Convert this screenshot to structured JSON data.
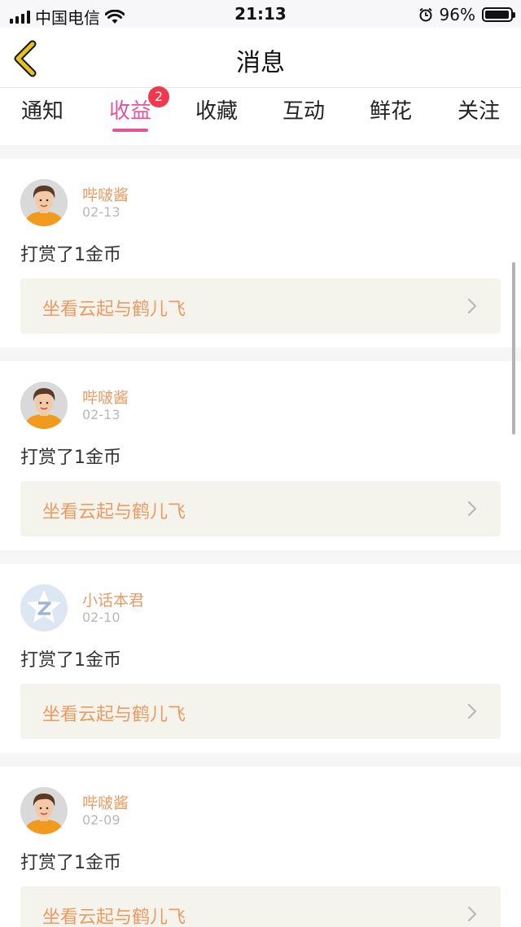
{
  "status_bar": {
    "carrier": "中国电信",
    "time": "21:13",
    "battery": "96%",
    "battery_level": 0.96
  },
  "nav": {
    "title": "消息",
    "back_icon": "chevron-left-icon"
  },
  "tabs": [
    {
      "label": "通知"
    },
    {
      "label": "收益",
      "badge": "2",
      "active": true
    },
    {
      "label": "收藏"
    },
    {
      "label": "互动"
    },
    {
      "label": "鲜花"
    },
    {
      "label": "关注"
    }
  ],
  "messages": [
    {
      "user": "哔啵酱",
      "date": "02-13",
      "text": "打赏了1金币",
      "work": "坐看云起与鹤儿飞",
      "avatar": "photo-avatar"
    },
    {
      "user": "哔啵酱",
      "date": "02-13",
      "text": "打赏了1金币",
      "work": "坐看云起与鹤儿飞",
      "avatar": "photo-avatar"
    },
    {
      "user": "小话本君",
      "date": "02-10",
      "text": "打赏了1金币",
      "work": "坐看云起与鹤儿飞",
      "avatar": "z-star-avatar"
    },
    {
      "user": "哔啵酱",
      "date": "02-09",
      "text": "打赏了1金币",
      "work": "坐看云起与鹤儿飞",
      "avatar": "photo-avatar"
    }
  ],
  "colors": {
    "accent": "#e0569d",
    "badge": "#f0384f",
    "name": "#e89b62",
    "link_text": "#ec9a64",
    "link_bg": "#f5f4ec",
    "back_icon": "#e8c11c"
  }
}
